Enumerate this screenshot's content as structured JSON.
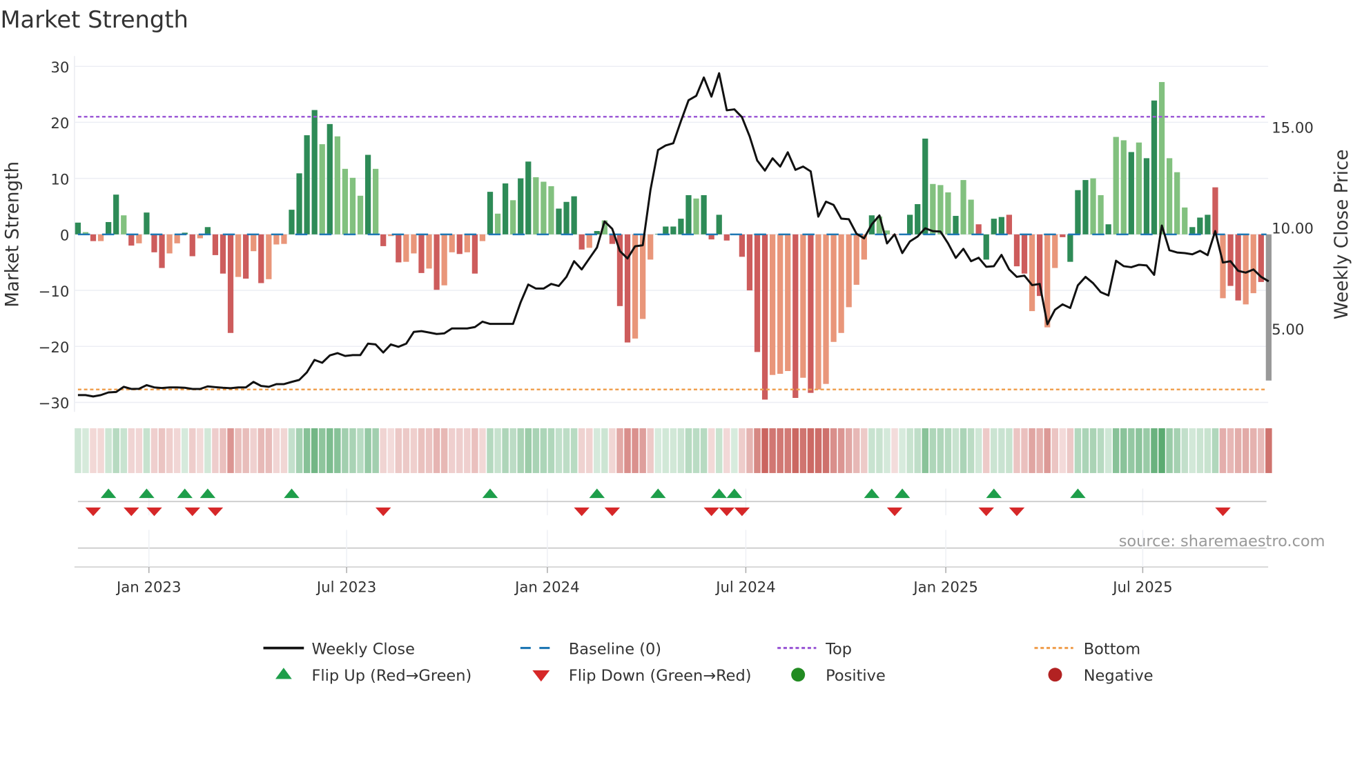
{
  "title": "Market Strength",
  "source": "source: sharemaestro.com",
  "chart_data": {
    "type": "bar",
    "title": "Market Strength",
    "frequency": "weekly",
    "ylabel": "Market Strength",
    "y2label": "Weekly Close Price",
    "ylim": [
      -32,
      32
    ],
    "y2lim": [
      1.32,
      17.99
    ],
    "yticks": [
      "30",
      "20",
      "10",
      "0",
      "−10",
      "−20",
      "−30"
    ],
    "ytick_values": [
      30,
      20,
      10,
      0,
      -10,
      -20,
      -30
    ],
    "y2ticks": [
      "15.00",
      "10.00",
      "5.00"
    ],
    "y2tick_values": [
      15,
      10,
      5
    ],
    "xticks": [
      "Jan 2023",
      "Jul 2023",
      "Jan 2024",
      "Jul 2024",
      "Jan 2025",
      "Jul 2025"
    ],
    "xtick_week_index": [
      9.3,
      35.2,
      61.5,
      87.5,
      113.7,
      139.5
    ],
    "top": 21,
    "bottom": -27.7,
    "baseline": 0,
    "strength": [
      2.1,
      0.4,
      -1.2,
      -1.2,
      2.2,
      7.1,
      3.4,
      -2.0,
      -1.6,
      3.9,
      -3.2,
      -6.0,
      -3.4,
      -1.6,
      0.3,
      -3.9,
      -0.7,
      1.3,
      -3.7,
      -7.0,
      -17.6,
      -7.6,
      -7.9,
      -3.0,
      -8.7,
      -8.0,
      -1.8,
      -1.7,
      4.4,
      10.9,
      17.7,
      22.2,
      16.1,
      19.7,
      17.5,
      11.7,
      10.1,
      6.9,
      14.2,
      11.7,
      -2.1,
      -0.3,
      -5.0,
      -4.9,
      -3.4,
      -6.9,
      -6.1,
      -9.9,
      -9.1,
      -3.2,
      -3.5,
      -3.2,
      -7.0,
      -1.2,
      7.6,
      3.7,
      9.1,
      6.1,
      10.0,
      13.0,
      10.2,
      9.4,
      8.6,
      4.6,
      5.8,
      6.8,
      -2.7,
      -2.4,
      0.6,
      2.5,
      -1.7,
      -12.8,
      -19.3,
      -18.6,
      -15.1,
      -4.5,
      0.1,
      1.4,
      1.4,
      2.8,
      7.0,
      6.4,
      7.0,
      -0.9,
      3.5,
      -1.1,
      0.1,
      -4.0,
      -10.0,
      -21.0,
      -29.5,
      -25.1,
      -24.9,
      -24.4,
      -29.2,
      -25.6,
      -28.3,
      -27.7,
      -26.7,
      -19.2,
      -17.6,
      -13.0,
      -9.0,
      -4.5,
      3.4,
      3.2,
      0.7,
      -0.1,
      0.1,
      3.5,
      5.4,
      17.1,
      9.0,
      8.8,
      7.5,
      3.3,
      9.7,
      6.2,
      1.8,
      -4.5,
      2.8,
      3.1,
      3.5,
      -5.7,
      -7.0,
      -13.7,
      -11.0,
      -16.6,
      -6.0,
      -0.5,
      -4.9,
      7.9,
      9.7,
      10.0,
      7.0,
      1.8,
      17.4,
      16.8,
      14.7,
      16.4,
      13.6,
      23.9,
      27.2,
      13.6,
      11.1,
      4.8,
      1.3,
      3.0,
      3.5,
      8.4,
      -11.4,
      -9.2,
      -11.8,
      -12.5,
      -10.5,
      -8.5,
      -26.1
    ],
    "tone": "GgRrGGgRrGRRrrGRrGRRRrRrRrrrGGGGgGggggGgRrRrrRrRrrRrRrGgGgGGgggGGGRrGgRRRrrrGGGGGgGRGRGRRRRrrrRrRrrrrrrrGggRGGGGgggGggRGGGRRRrRrrRGGGggGggGgGGggggGGGRrRRrrR",
    "tone_key": {
      "G": "positive-strengthening",
      "g": "positive-weakening",
      "R": "negative-strengthening",
      "r": "negative-weakening"
    },
    "weekly_close": [
      1.69,
      1.69,
      1.62,
      1.69,
      1.82,
      1.84,
      2.1,
      1.99,
      2.0,
      2.18,
      2.07,
      2.04,
      2.07,
      2.07,
      2.05,
      1.99,
      1.99,
      2.12,
      2.08,
      2.05,
      2.03,
      2.07,
      2.07,
      2.34,
      2.14,
      2.1,
      2.23,
      2.23,
      2.34,
      2.44,
      2.82,
      3.43,
      3.29,
      3.66,
      3.77,
      3.63,
      3.67,
      3.67,
      4.24,
      4.2,
      3.8,
      4.2,
      4.08,
      4.24,
      4.82,
      4.86,
      4.79,
      4.72,
      4.75,
      4.99,
      4.99,
      4.99,
      5.06,
      5.33,
      5.22,
      5.22,
      5.22,
      5.22,
      6.29,
      7.17,
      6.97,
      6.97,
      7.2,
      7.1,
      7.55,
      8.33,
      7.92,
      8.46,
      9.01,
      10.3,
      9.93,
      8.83,
      8.46,
      9.07,
      9.12,
      11.86,
      13.84,
      14.07,
      14.18,
      15.27,
      16.31,
      16.53,
      17.44,
      16.49,
      17.65,
      15.81,
      15.86,
      15.47,
      14.52,
      13.32,
      12.82,
      13.43,
      13.02,
      13.73,
      12.86,
      13.02,
      12.78,
      10.54,
      11.28,
      11.12,
      10.44,
      10.41,
      9.69,
      9.46,
      10.16,
      10.6,
      9.21,
      9.66,
      8.73,
      9.31,
      9.55,
      9.96,
      9.82,
      9.8,
      9.21,
      8.49,
      8.94,
      8.33,
      8.5,
      8.05,
      8.08,
      8.64,
      7.92,
      7.55,
      7.61,
      7.14,
      7.2,
      5.2,
      5.92,
      6.19,
      6.01,
      7.13,
      7.55,
      7.24,
      6.79,
      6.63,
      8.35,
      8.08,
      8.03,
      8.15,
      8.12,
      7.65,
      10.1,
      8.87,
      8.76,
      8.73,
      8.67,
      8.84,
      8.63,
      9.82,
      8.26,
      8.33,
      7.85,
      7.76,
      7.92,
      7.55,
      7.33
    ],
    "flip_up_week_index": [
      4,
      9,
      14,
      17,
      28,
      54,
      68,
      76,
      84,
      86,
      104,
      108,
      120,
      131
    ],
    "flip_down_week_index": [
      2,
      7,
      10,
      15,
      18,
      40,
      66,
      70,
      83,
      85,
      87,
      107,
      119,
      123,
      150
    ],
    "legend_position": "bottom",
    "grid": true
  },
  "legend": {
    "weekly_close": "Weekly Close",
    "baseline": "Baseline (0)",
    "top": "Top",
    "bottom": "Bottom",
    "flip_up": "Flip Up (Red→Green)",
    "flip_down": "Flip Down (Green→Red)",
    "positive": "Positive",
    "negative": "Negative"
  },
  "colors": {
    "strong_green": "#2e8b57",
    "weak_green": "#82c17f",
    "strong_red": "#cd5c5c",
    "weak_red": "#e9967a",
    "baseline": "#1f77b4",
    "top": "#9b59d6",
    "bottom": "#f0a050",
    "price": "#111111",
    "flip_up": "#1e9e4a",
    "flip_down": "#d62728",
    "positive": "#228b22",
    "negative": "#b22222"
  }
}
